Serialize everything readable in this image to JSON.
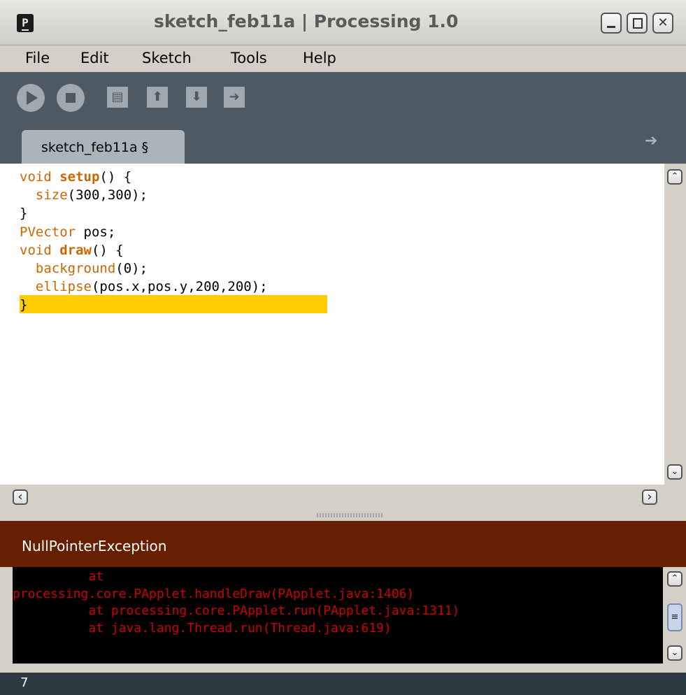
{
  "window": {
    "app_icon_glyph": "P",
    "title": "sketch_feb11a | Processing 1.0",
    "controls": {
      "minimize_icon": "minimize-icon",
      "maximize_icon": "maximize-icon",
      "close_icon": "close-icon",
      "close_glyph": "✕"
    }
  },
  "menu": {
    "items": [
      "File",
      "Edit",
      "Sketch",
      "Tools",
      "Help"
    ]
  },
  "toolbar": {
    "buttons": [
      {
        "icon": "run-icon"
      },
      {
        "icon": "stop-icon"
      },
      {
        "icon": "new-icon",
        "glyph": "▤"
      },
      {
        "icon": "open-icon",
        "glyph": "⬆"
      },
      {
        "icon": "save-icon",
        "glyph": "⬇"
      },
      {
        "icon": "export-icon",
        "glyph": "➜"
      }
    ]
  },
  "tabs": {
    "items": [
      {
        "label": "sketch_feb11a §"
      }
    ],
    "menu_arrow_glyph": "➔"
  },
  "editor": {
    "lines": [
      [
        {
          "t": "void ",
          "c": "kw"
        },
        {
          "t": "setup",
          "c": "kwb"
        },
        {
          "t": "() {",
          "c": ""
        }
      ],
      [
        {
          "t": "  size",
          "c": "kw"
        },
        {
          "t": "(300,300);",
          "c": ""
        }
      ],
      [
        {
          "t": "}",
          "c": ""
        }
      ],
      [
        {
          "t": "PVector",
          "c": "kw"
        },
        {
          "t": " pos;",
          "c": ""
        }
      ],
      [
        {
          "t": "void ",
          "c": "kw"
        },
        {
          "t": "draw",
          "c": "kwb"
        },
        {
          "t": "() {",
          "c": ""
        }
      ],
      [
        {
          "t": "  background",
          "c": "kw"
        },
        {
          "t": "(0);",
          "c": ""
        }
      ],
      [
        {
          "t": "  ellipse",
          "c": "kw"
        },
        {
          "t": "(pos.x,pos.y,200,200);",
          "c": ""
        }
      ],
      [
        {
          "t": "}",
          "c": ""
        }
      ]
    ],
    "highlighted_line": 7,
    "highlight_color": "#ffcc00",
    "keyword_color": "#cc6600"
  },
  "scroll_glyphs": {
    "up": "⌃",
    "down": "⌄",
    "left": "‹",
    "right": "›"
  },
  "message": {
    "text": "NullPointerException",
    "background": "#662000"
  },
  "console": {
    "lines": [
      "          at",
      "processing.core.PApplet.handleDraw(PApplet.java:1406)",
      "          at processing.core.PApplet.run(PApplet.java:1311)",
      "          at java.lang.Thread.run(Thread.java:619)"
    ],
    "text_color": "#cc0000"
  },
  "status": {
    "line_number": "7"
  }
}
